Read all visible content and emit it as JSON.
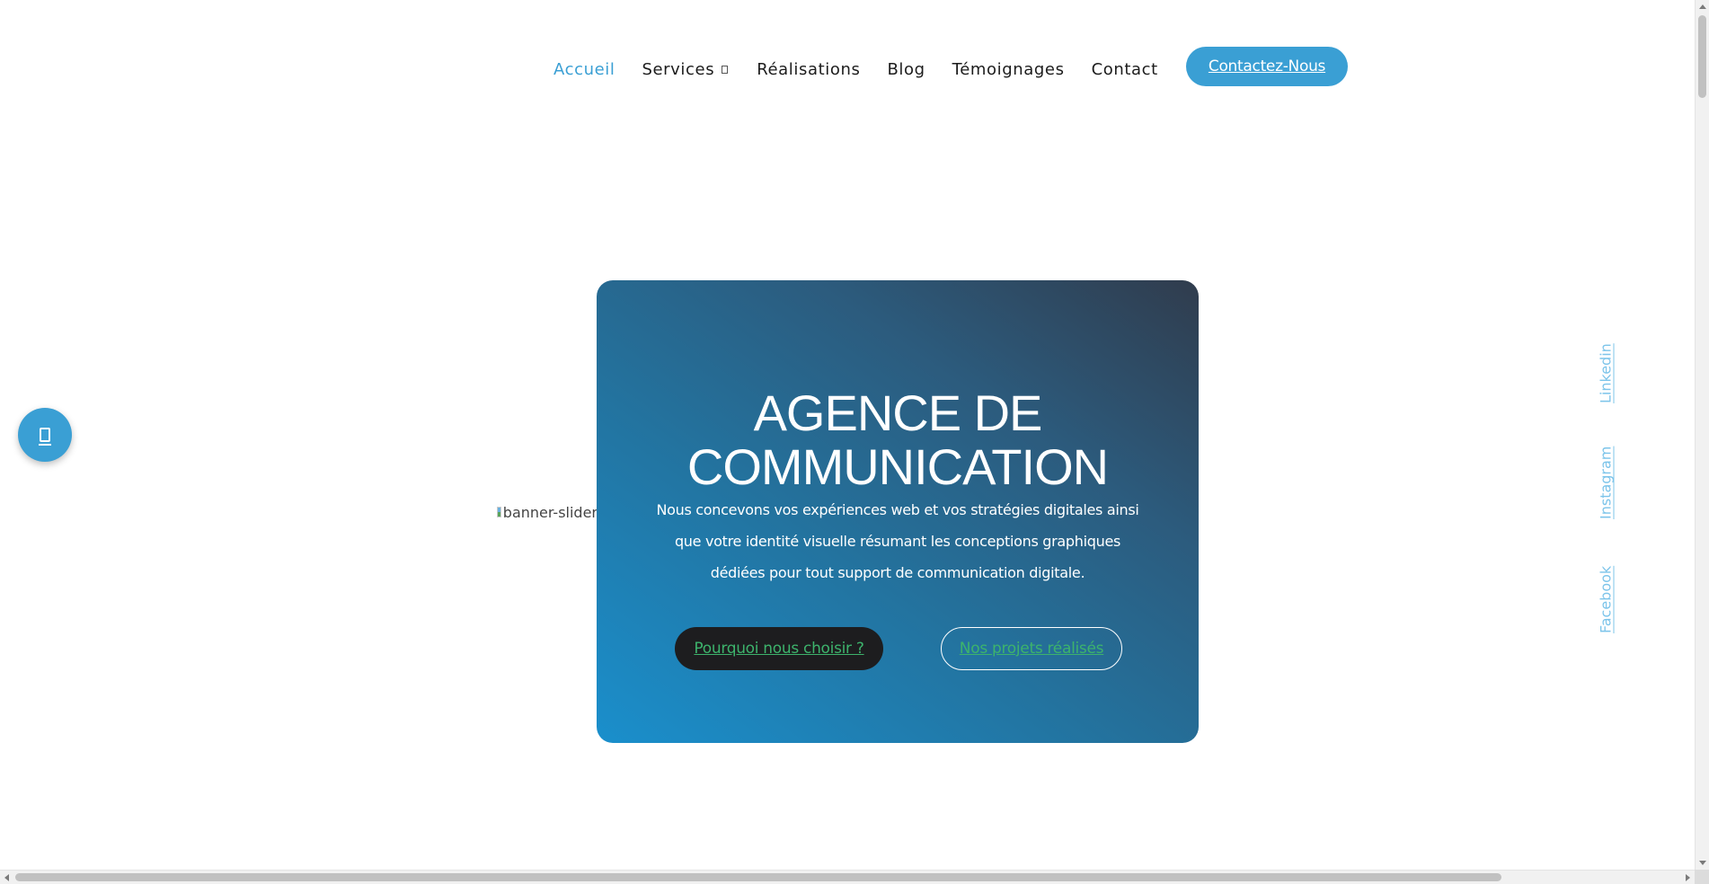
{
  "nav": {
    "items": [
      {
        "label": "Accueil",
        "active": true
      },
      {
        "label": "Services",
        "active": false,
        "has_dropdown": true
      },
      {
        "label": "Réalisations",
        "active": false
      },
      {
        "label": "Blog",
        "active": false
      },
      {
        "label": "Témoignages",
        "active": false
      },
      {
        "label": "Contact",
        "active": false
      }
    ],
    "cta_label": "Contactez-Nous"
  },
  "hero": {
    "title_line1": "AGENCE DE",
    "title_line2": "COMMUNICATION",
    "description": "Nous concevons vos expériences web et vos stratégies digitales ainsi que votre identité visuelle résumant les conceptions graphiques dédiées pour tout support de communication digitale.",
    "primary_button": "Pourquoi nous choisir ?",
    "secondary_button": "Nos projets réalisés"
  },
  "banner_image": {
    "alt": "banner-slider"
  },
  "floating_button": {
    "icon": "phone-icon"
  },
  "social": {
    "linkedin": "Linkedin",
    "instagram": "Instagram",
    "facebook": "Facebook"
  },
  "colors": {
    "accent": "#3a9fd4",
    "button_text_green": "#3db36c",
    "dark_button": "#1d1d1f",
    "hero_gradient_start": "#1a8fcc",
    "hero_gradient_end": "#303c4d",
    "social_link": "#7cc4ea"
  }
}
